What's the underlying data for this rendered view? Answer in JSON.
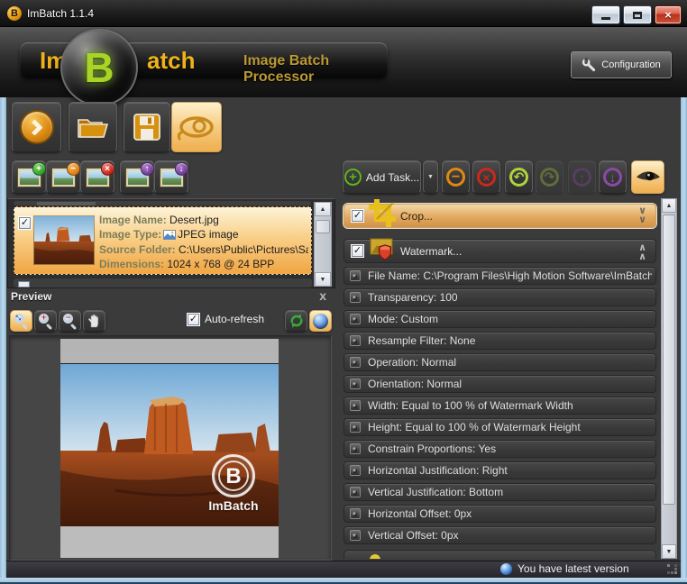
{
  "window": {
    "title": "ImBatch 1.1.4",
    "app_initial": "B"
  },
  "header": {
    "logo": {
      "prefix": "Im",
      "initial": "B",
      "suffix": "atch",
      "tagline": "Image Batch Processor"
    },
    "configuration_label": "Configuration"
  },
  "image_list": {
    "item": {
      "checked": true,
      "name_label": "Image Name:",
      "name_value": "Desert.jpg",
      "type_label": "Image Type:",
      "type_value": "JPEG image",
      "folder_label": "Source Folder:",
      "folder_value": "C:\\Users\\Public\\Pictures\\Sam...",
      "dims_label": "Dimensions:",
      "dims_value": "1024 x 768 @ 24 BPP"
    }
  },
  "preview": {
    "title": "Preview",
    "close_glyph": "x",
    "auto_refresh_label": "Auto-refresh",
    "watermark_initial": "B",
    "watermark_text": "ImBatch"
  },
  "task_panel": {
    "add_task_label": "Add Task...",
    "tasks": [
      {
        "label": "Crop...",
        "checked": true
      },
      {
        "label": "Watermark...",
        "checked": true
      }
    ],
    "properties": [
      "File Name: C:\\Program Files\\High Motion Software\\ImBatch\\Graphics",
      "Transparency: 100",
      "Mode: Custom",
      "Resample Filter: None",
      "Operation: Normal",
      "Orientation: Normal",
      "Width: Equal to 100 % of Watermark Width",
      "Height: Equal to 100 % of Watermark Height",
      "Constrain Proportions: Yes",
      "Horizontal Justification: Right",
      "Vertical Justification: Bottom",
      "Horizontal Offset: 0px",
      "Vertical Offset: 0px"
    ]
  },
  "status_bar": {
    "message": "You have latest version"
  },
  "icons": {
    "check": "✓",
    "window_close": "×",
    "dropdown": "▼",
    "scroll_up": "▲",
    "scroll_down": "▼",
    "chevron_down": "∨",
    "chevron_up": "∧",
    "minus": "−",
    "cross": "×",
    "plus": "+",
    "undo": "↶",
    "redo": "↷",
    "arrow_up": "↑",
    "arrow_down": "↓"
  }
}
